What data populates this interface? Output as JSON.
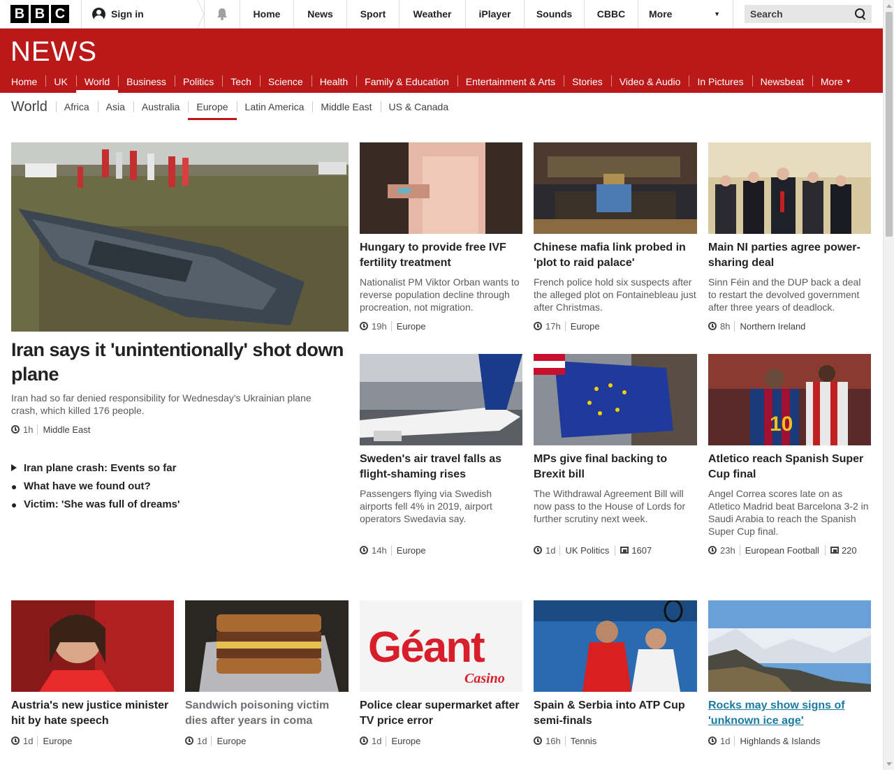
{
  "topbar": {
    "logo_letters": [
      "B",
      "B",
      "C"
    ],
    "signin_label": "Sign in",
    "nav": [
      {
        "label": "Home",
        "name": "home"
      },
      {
        "label": "News",
        "name": "news"
      },
      {
        "label": "Sport",
        "name": "sport"
      },
      {
        "label": "Weather",
        "name": "weather"
      },
      {
        "label": "iPlayer",
        "name": "iplayer"
      },
      {
        "label": "Sounds",
        "name": "sounds"
      },
      {
        "label": "CBBC",
        "name": "cbbc"
      }
    ],
    "more_label": "More",
    "search_placeholder": "Search"
  },
  "masthead": {
    "logo_text": "NEWS",
    "nav": [
      "Home",
      "UK",
      "World",
      "Business",
      "Politics",
      "Tech",
      "Science",
      "Health",
      "Family & Education",
      "Entertainment & Arts",
      "Stories",
      "Video & Audio",
      "In Pictures",
      "Newsbeat",
      "More"
    ],
    "active": "World"
  },
  "subnav": {
    "title": "World",
    "items": [
      "Africa",
      "Asia",
      "Australia",
      "Europe",
      "Latin America",
      "Middle East",
      "US & Canada"
    ],
    "active": "Europe"
  },
  "lead": {
    "headline": "Iran says it 'unintentionally' shot down plane",
    "summary": "Iran had so far denied responsibility for Wednesday's Ukrainian plane crash, which killed 176 people.",
    "time": "1h",
    "section": "Middle East",
    "related": [
      {
        "label": "Iran plane crash: Events so far",
        "type": "play"
      },
      {
        "label": "What have we found out?",
        "type": "dot"
      },
      {
        "label": "Victim: 'She was full of dreams'",
        "type": "dot"
      }
    ]
  },
  "stories": [
    {
      "headline": "Hungary to provide free IVF fertility treatment",
      "summary": "Nationalist PM Viktor Orban wants to reverse population decline through procreation, not migration.",
      "time": "19h",
      "section": "Europe"
    },
    {
      "headline": "Chinese mafia link probed in 'plot to raid palace'",
      "summary": "French police hold six suspects after the alleged plot on Fontainebleau just after Christmas.",
      "time": "17h",
      "section": "Europe"
    },
    {
      "headline": "Main NI parties agree power-sharing deal",
      "summary": "Sinn Féin and the DUP back a deal to restart the devolved government after three years of deadlock.",
      "time": "8h",
      "section": "Northern Ireland"
    },
    {
      "headline": "Sweden's air travel falls as flight-shaming rises",
      "summary": "Passengers flying via Swedish airports fell 4% in 2019, airport operators Swedavia say.",
      "time": "14h",
      "section": "Europe"
    },
    {
      "headline": "MPs give final backing to Brexit bill",
      "summary": "The Withdrawal Agreement Bill will now pass to the House of Lords for further scrutiny next week.",
      "time": "1d",
      "section": "UK Politics",
      "comments": "1607"
    },
    {
      "headline": "Atletico reach Spanish Super Cup final",
      "summary": "Angel Correa scores late on as Atletico Madrid beat Barcelona 3-2 in Saudi Arabia to reach the Spanish Super Cup final.",
      "time": "23h",
      "section": "European Football",
      "comments": "220"
    }
  ],
  "bottom": [
    {
      "headline": "Austria's new justice minister hit by hate speech",
      "time": "1d",
      "section": "Europe"
    },
    {
      "headline": "Sandwich poisoning victim dies after years in coma",
      "time": "1d",
      "section": "Europe"
    },
    {
      "headline": "Police clear supermarket after TV price error",
      "time": "1d",
      "section": "Europe",
      "image_text_1": "Géant",
      "image_text_2": "Casino"
    },
    {
      "headline": "Spain & Serbia into ATP Cup semi-finals",
      "time": "16h",
      "section": "Tennis"
    },
    {
      "headline": "Rocks may show signs of 'unknown ice age'",
      "time": "1d",
      "section": "Highlands & Islands"
    }
  ],
  "colors": {
    "brand_red": "#bb1919",
    "text": "#222222",
    "muted": "#5a5a5a",
    "link": "#1d7aa2"
  }
}
